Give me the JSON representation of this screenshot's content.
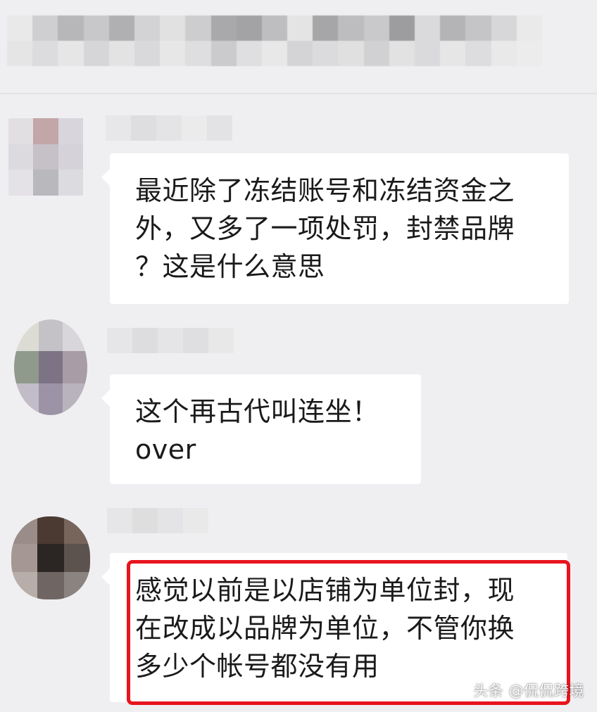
{
  "messages": [
    {
      "lines": [
        "最近除了冻结账号和冻结资金之",
        "外，又多了一项处罚，封禁品牌",
        "？这是什么意思"
      ]
    },
    {
      "lines": [
        "这个再古代叫连坐！",
        "over"
      ]
    },
    {
      "lines": [
        "感觉以前是以店铺为单位封，现",
        "在改成以品牌为单位，不管你换",
        "多少个帐号都没有用"
      ],
      "highlighted": true,
      "highlight_color": "#e8141e"
    }
  ],
  "watermark": "头条 @侃侃跨境",
  "colors": {
    "background": "#efeff1",
    "bubble": "#ffffff",
    "text": "#1a1a1a"
  }
}
